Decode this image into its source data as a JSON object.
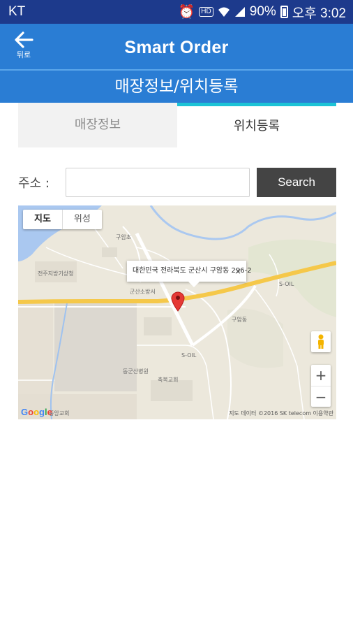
{
  "status_bar": {
    "carrier": "KT",
    "battery": "90%",
    "time": "오후 3:02"
  },
  "app_bar": {
    "back_label": "뒤로",
    "title": "Smart Order"
  },
  "sub_header": {
    "title": "매장정보/위치등록"
  },
  "tabs": [
    {
      "label": "매장정보",
      "selected": false
    },
    {
      "label": "위치등록",
      "selected": true
    }
  ],
  "address": {
    "label": "주소 :",
    "value": "",
    "placeholder": "",
    "search_label": "Search"
  },
  "map": {
    "type_buttons": [
      "지도",
      "위성"
    ],
    "info_window_text": "대한민국 전라북도 군산시 구암동 296-2",
    "info_close": "×",
    "zoom_in": "+",
    "zoom_out": "−",
    "google_logo": "Google",
    "attribution": "지도 데이터 ©2016 SK telecom  이용약관",
    "labels": {
      "school1": "구암초",
      "area1": "전주지방기상청",
      "oil1": "S-OIL",
      "church1": "축복교회",
      "dong1": "구암동",
      "station1": "군산소방서",
      "hospital": "동군산병원",
      "church2": "중앙교회"
    }
  },
  "colors": {
    "status_bar": "#1d3a8c",
    "app_bar": "#2a7dd4",
    "tab_indicator": "#1cc3d6",
    "search_button": "#444444",
    "pin": "#e53935"
  }
}
